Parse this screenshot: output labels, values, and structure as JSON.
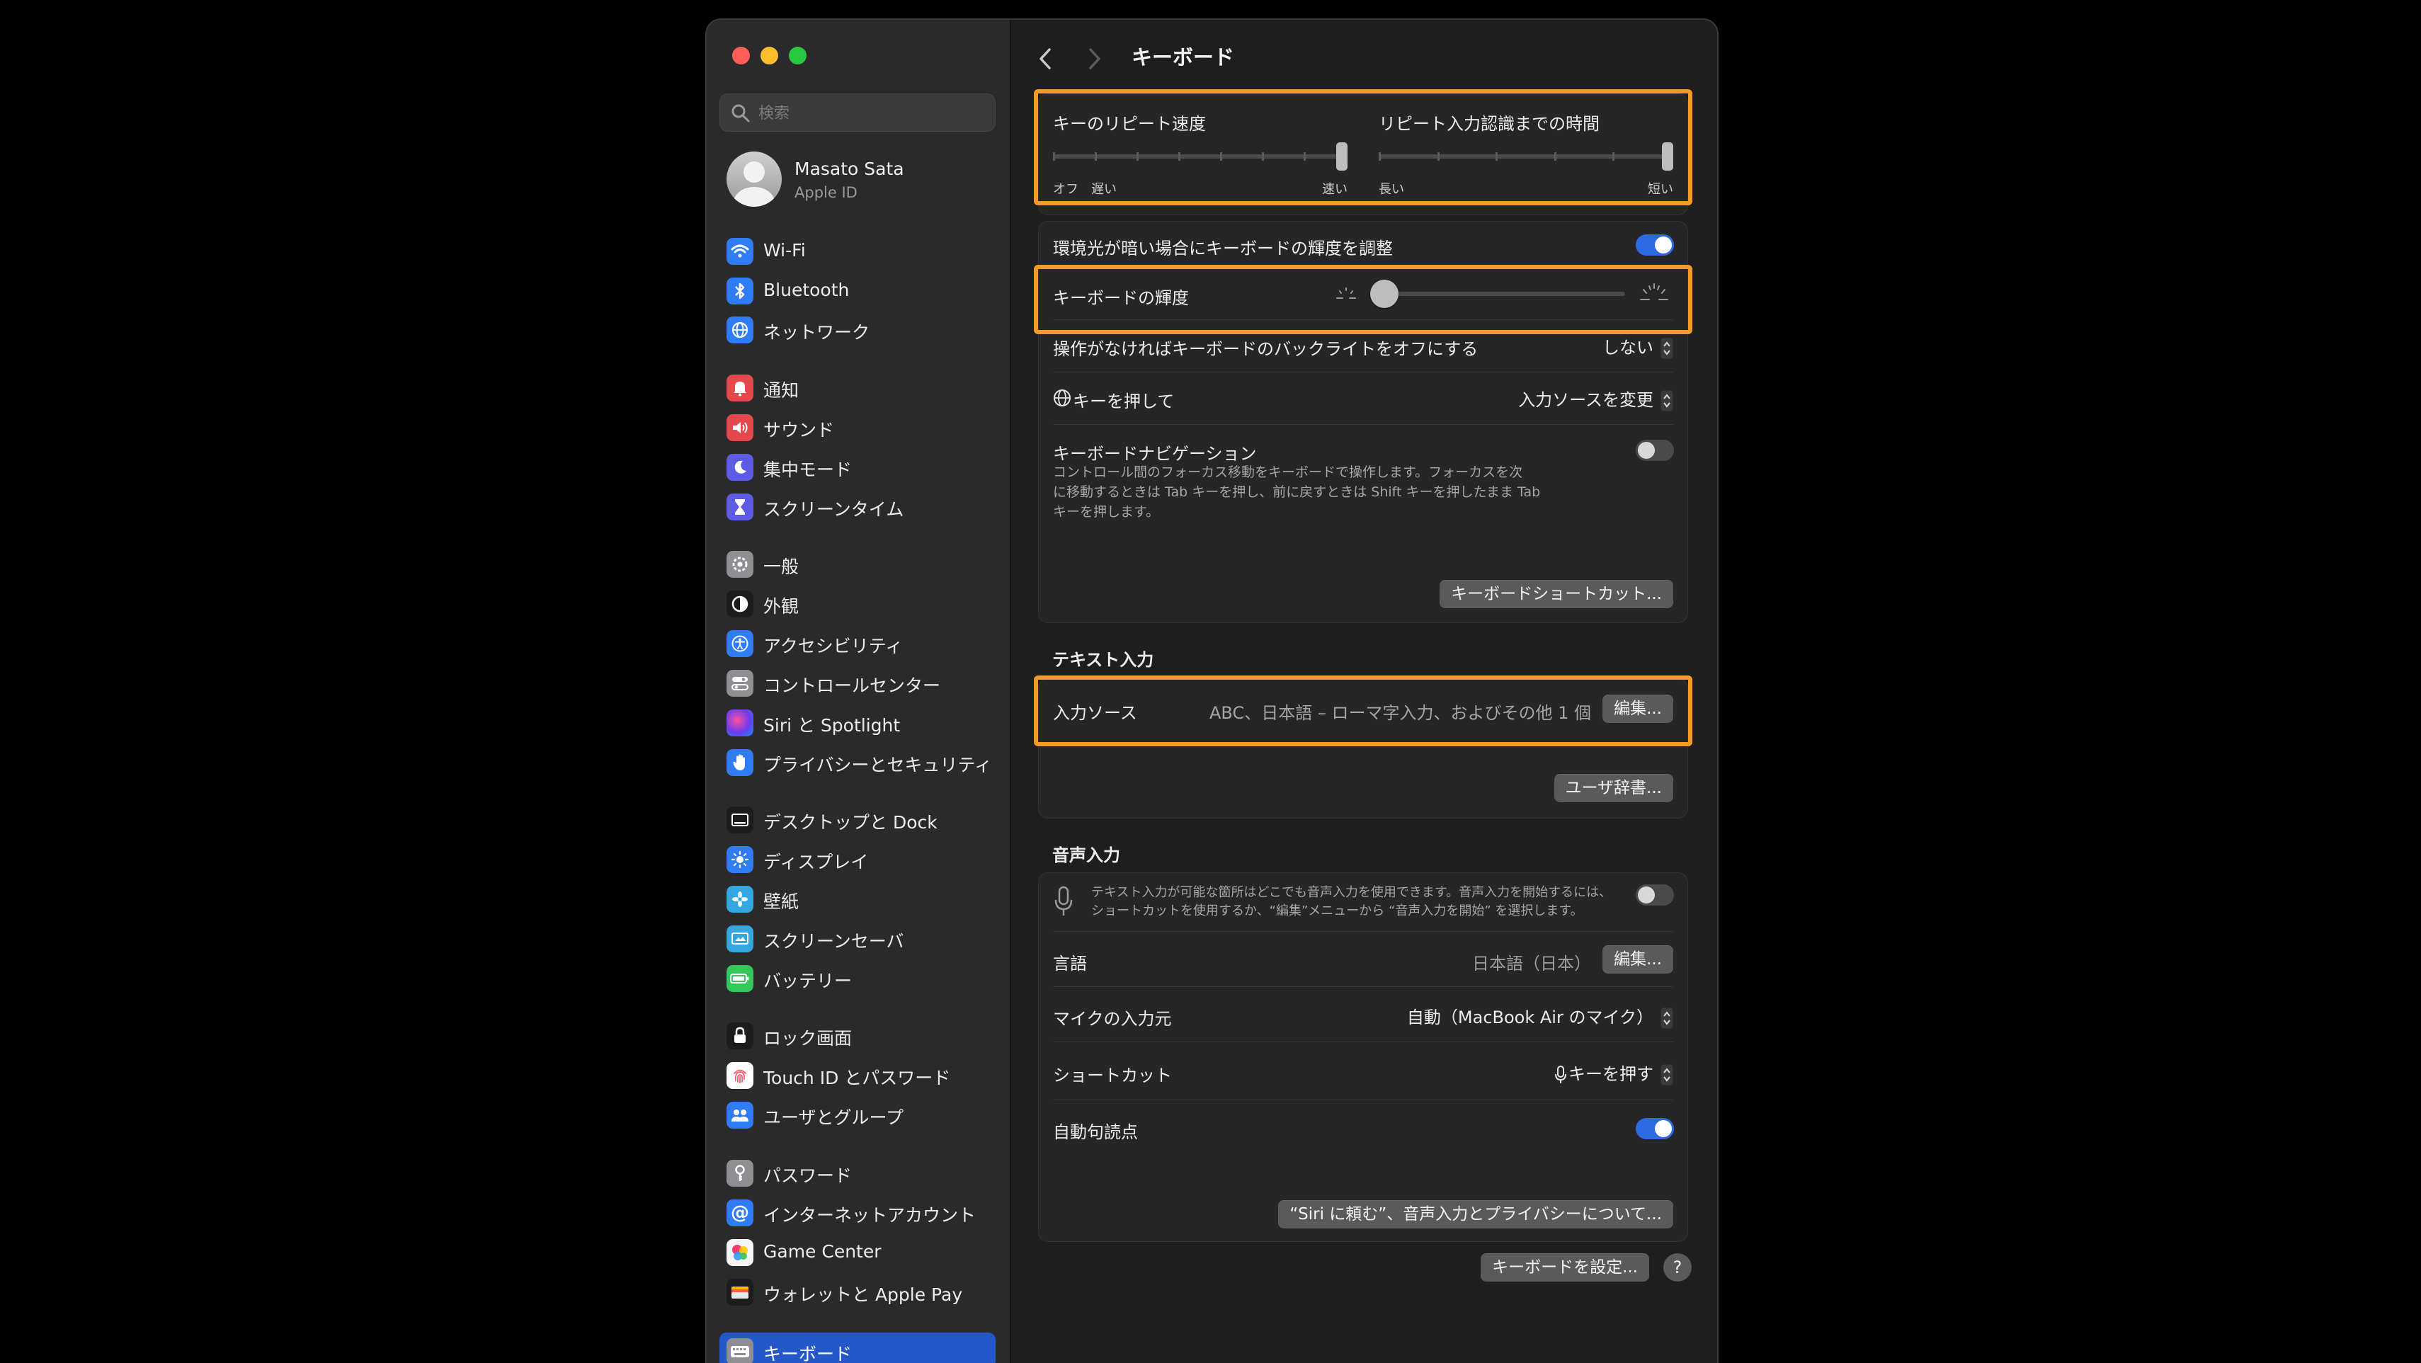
{
  "sidebar": {
    "search_placeholder": "検索",
    "profile": {
      "name": "Masato Sata",
      "subtitle": "Apple ID"
    },
    "items": [
      {
        "label": "Wi-Fi",
        "icon": "wifi-icon",
        "color": "#2f7cf6"
      },
      {
        "label": "Bluetooth",
        "icon": "bluetooth-icon",
        "color": "#2f7cf6"
      },
      {
        "label": "ネットワーク",
        "icon": "globe-icon",
        "color": "#2f7cf6"
      },
      {
        "label": "通知",
        "icon": "bell-icon",
        "color": "#e5484d"
      },
      {
        "label": "サウンド",
        "icon": "speaker-icon",
        "color": "#e5484d"
      },
      {
        "label": "集中モード",
        "icon": "moon-icon",
        "color": "#5e5ce6"
      },
      {
        "label": "スクリーンタイム",
        "icon": "hourglass-icon",
        "color": "#5e5ce6"
      },
      {
        "label": "一般",
        "icon": "gear-icon",
        "color": "#8e8e93"
      },
      {
        "label": "外観",
        "icon": "appearance-icon",
        "color": "#1c1c1e"
      },
      {
        "label": "アクセシビリティ",
        "icon": "accessibility-icon",
        "color": "#2f7cf6"
      },
      {
        "label": "コントロールセンター",
        "icon": "control-center-icon",
        "color": "#8e8e93"
      },
      {
        "label": "Siri と Spotlight",
        "icon": "siri-icon",
        "color": "#7a3cc9"
      },
      {
        "label": "プライバシーとセキュリティ",
        "icon": "hand-icon",
        "color": "#2f7cf6"
      },
      {
        "label": "デスクトップと Dock",
        "icon": "dock-icon",
        "color": "#1c1c1e"
      },
      {
        "label": "ディスプレイ",
        "icon": "sun-icon",
        "color": "#2f7cf6"
      },
      {
        "label": "壁紙",
        "icon": "flower-icon",
        "color": "#35a7e0"
      },
      {
        "label": "スクリーンセーバ",
        "icon": "screensaver-icon",
        "color": "#35a7e0"
      },
      {
        "label": "バッテリー",
        "icon": "battery-icon",
        "color": "#34c759"
      },
      {
        "label": "ロック画面",
        "icon": "lock-icon",
        "color": "#1c1c1e"
      },
      {
        "label": "Touch ID とパスワード",
        "icon": "fingerprint-icon",
        "color": "#ff6f6f"
      },
      {
        "label": "ユーザとグループ",
        "icon": "users-icon",
        "color": "#2f7cf6"
      },
      {
        "label": "パスワード",
        "icon": "key-icon",
        "color": "#8e8e93"
      },
      {
        "label": "インターネットアカウント",
        "icon": "at-icon",
        "color": "#2f7cf6"
      },
      {
        "label": "Game Center",
        "icon": "game-center-icon",
        "color": "#f5f5f5"
      },
      {
        "label": "ウォレットと Apple Pay",
        "icon": "wallet-icon",
        "color": "#1c1c1e"
      },
      {
        "label": "キーボード",
        "icon": "keyboard-icon",
        "color": "#8e8e93",
        "active": true
      }
    ]
  },
  "main": {
    "title": "キーボード",
    "repeat": {
      "key_repeat_label": "キーのリピート速度",
      "delay_label": "リピート入力認識までの時間",
      "key_repeat_min_off": "オフ",
      "key_repeat_min": "遅い",
      "key_repeat_max": "速い",
      "delay_min": "長い",
      "delay_max": "短い",
      "key_repeat_value": 1.0,
      "delay_value": 1.0
    },
    "backlight": {
      "auto_label": "環境光が暗い場合にキーボードの輝度を調整",
      "auto_on": true,
      "brightness_label": "キーボードの輝度",
      "brightness_value": 0.0,
      "off_label": "操作がなければキーボードのバックライトをオフにする",
      "off_value": "しない",
      "globe_label": "キーを押して",
      "globe_value": "入力ソースを変更",
      "nav_label": "キーボードナビゲーション",
      "nav_desc_1": "コントロール間のフォーカス移動をキーボードで操作します。フォーカスを次",
      "nav_desc_2": "に移動するときは Tab キーを押し、前に戻すときは Shift キーを押したまま Tab",
      "nav_desc_3": "キーを押します。",
      "nav_on": false,
      "shortcuts_button": "キーボードショートカット..."
    },
    "text_input": {
      "section_title": "テキスト入力",
      "sources_label": "入力ソース",
      "sources_value": "ABC、日本語 – ローマ字入力、およびその他 1 個",
      "edit_button": "編集...",
      "dictionary_button": "ユーザ辞書..."
    },
    "dictation": {
      "section_title": "音声入力",
      "desc_1": "テキスト入力が可能な箇所はどこでも音声入力を使用できます。音声入力を開始するには、",
      "desc_2": "ショートカットを使用するか、“編集”メニューから “音声入力を開始” を選択します。",
      "enabled": false,
      "language_label": "言語",
      "language_value": "日本語（日本）",
      "language_edit": "編集...",
      "mic_label": "マイクの入力元",
      "mic_value": "自動（MacBook Air のマイク）",
      "shortcut_label": "ショートカット",
      "shortcut_value": "キーを押す",
      "punct_label": "自動句読点",
      "punct_on": true,
      "siri_button": "“Siri に頼む”、音声入力とプライバシーについて..."
    },
    "setup_button": "キーボードを設定...",
    "help_button": "?"
  },
  "colors": {
    "accent": "#2d6be4",
    "highlight": "#f39a2b",
    "sidebar_active": "#2458c9"
  }
}
